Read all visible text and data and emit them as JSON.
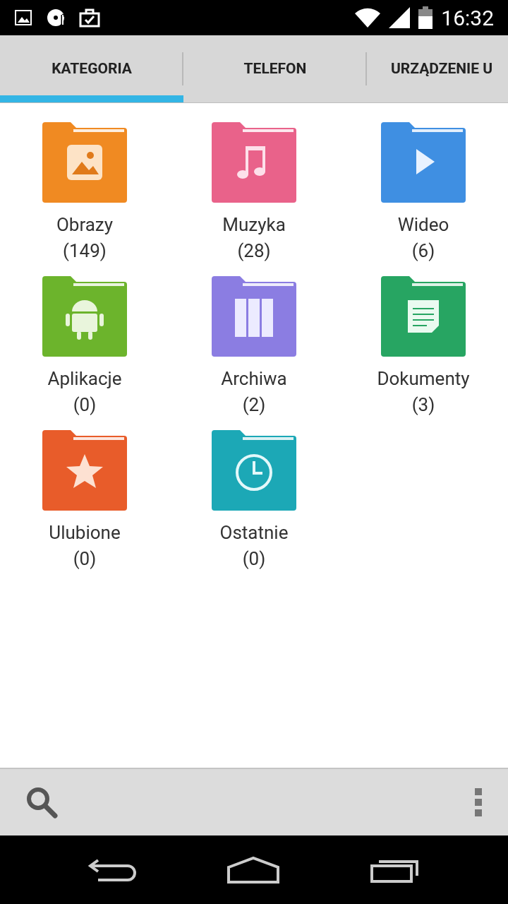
{
  "status_bar": {
    "time": "16:32"
  },
  "tabs": [
    {
      "label": "KATEGORIA",
      "selected": true
    },
    {
      "label": "TELEFON",
      "selected": false
    },
    {
      "label": "URZĄDZENIE U",
      "selected": false
    }
  ],
  "categories": [
    {
      "name": "Obrazy",
      "count": "(149)",
      "kind": "image",
      "color": "#f08a22"
    },
    {
      "name": "Muzyka",
      "count": "(28)",
      "kind": "music",
      "color": "#e9628a"
    },
    {
      "name": "Wideo",
      "count": "(6)",
      "kind": "video",
      "color": "#3f8fe2"
    },
    {
      "name": "Aplikacje",
      "count": "(0)",
      "kind": "android",
      "color": "#6cb42c"
    },
    {
      "name": "Archiwa",
      "count": "(2)",
      "kind": "archive",
      "color": "#8b7de2"
    },
    {
      "name": "Dokumenty",
      "count": "(3)",
      "kind": "document",
      "color": "#27a562"
    },
    {
      "name": "Ulubione",
      "count": "(0)",
      "kind": "star",
      "color": "#e85c2a"
    },
    {
      "name": "Ostatnie",
      "count": "(0)",
      "kind": "clock",
      "color": "#1ca8b6"
    }
  ]
}
